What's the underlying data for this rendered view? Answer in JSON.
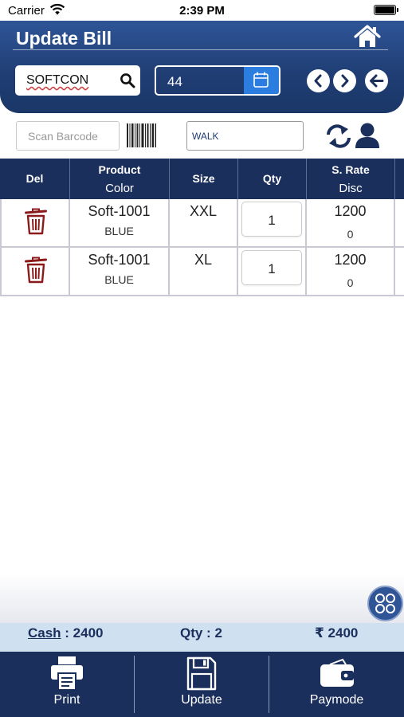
{
  "status_bar": {
    "carrier": "Carrier",
    "time": "2:39 PM"
  },
  "header": {
    "title": "Update Bill"
  },
  "filters": {
    "party": "SOFTCON",
    "bill_no": "44",
    "scan_placeholder": "Scan Barcode",
    "customer": "WALK"
  },
  "table": {
    "columns": [
      {
        "l1": "Del",
        "l2": ""
      },
      {
        "l1": "Product",
        "l2": "Color"
      },
      {
        "l1": "Size",
        "l2": ""
      },
      {
        "l1": "Qty",
        "l2": ""
      },
      {
        "l1": "S. Rate",
        "l2": "Disc"
      }
    ],
    "rows": [
      {
        "product": "Soft-1001",
        "color": "BLUE",
        "size": "XXL",
        "qty": "1",
        "rate": "1200",
        "disc": "0"
      },
      {
        "product": "Soft-1001",
        "color": "BLUE",
        "size": "XL",
        "qty": "1",
        "rate": "1200",
        "disc": "0"
      }
    ]
  },
  "summary": {
    "cash_label": "Cash",
    "cash_value": " : 2400",
    "qty": "Qty : 2",
    "amount": "₹ 2400"
  },
  "bottom_bar": {
    "print": "Print",
    "update": "Update",
    "paymode": "Paymode"
  },
  "colors": {
    "header": "#1f3d73",
    "table_header": "#1b2f5c",
    "summary_bg": "#cfe0f1",
    "accent": "#2b7de0",
    "trash": "#8b1a1a"
  }
}
